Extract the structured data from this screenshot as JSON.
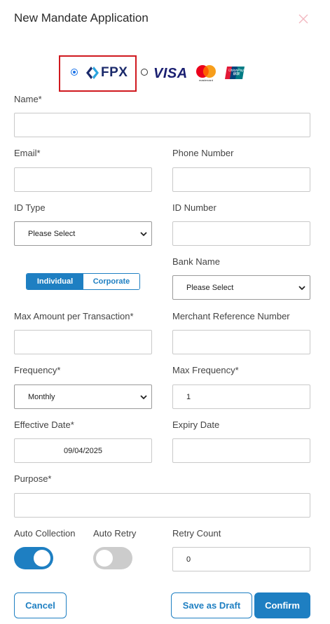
{
  "header": {
    "title": "New Mandate Application"
  },
  "payment_methods": {
    "fpx_label": "FPX",
    "visa_label": "VISA",
    "mastercard_label": "mastercard",
    "unionpay_label": "UnionPay 银联",
    "selected": "fpx"
  },
  "form": {
    "name_label": "Name*",
    "email_label": "Email*",
    "phone_label": "Phone Number",
    "id_type_label": "ID Type",
    "id_type_value": "Please Select",
    "id_number_label": "ID Number",
    "account_type": {
      "individual": "Individual",
      "corporate": "Corporate",
      "selected": "Individual"
    },
    "bank_name_label": "Bank Name",
    "bank_name_value": "Please Select",
    "max_amount_label": "Max Amount per Transaction*",
    "merchant_ref_label": "Merchant Reference Number",
    "frequency_label": "Frequency*",
    "frequency_value": "Monthly",
    "max_frequency_label": "Max Frequency*",
    "max_frequency_value": "1",
    "effective_date_label": "Effective Date*",
    "effective_date_value": "09/04/2025",
    "expiry_date_label": "Expiry Date",
    "purpose_label": "Purpose*",
    "auto_collection_label": "Auto Collection",
    "auto_collection_on": true,
    "auto_retry_label": "Auto Retry",
    "auto_retry_on": false,
    "retry_count_label": "Retry Count",
    "retry_count_value": "0"
  },
  "footer": {
    "cancel_label": "Cancel",
    "save_draft_label": "Save as Draft",
    "confirm_label": "Confirm"
  },
  "colors": {
    "accent": "#1e7fc2",
    "selected_outline": "#d0191f",
    "toggle_off": "#cccccc"
  }
}
